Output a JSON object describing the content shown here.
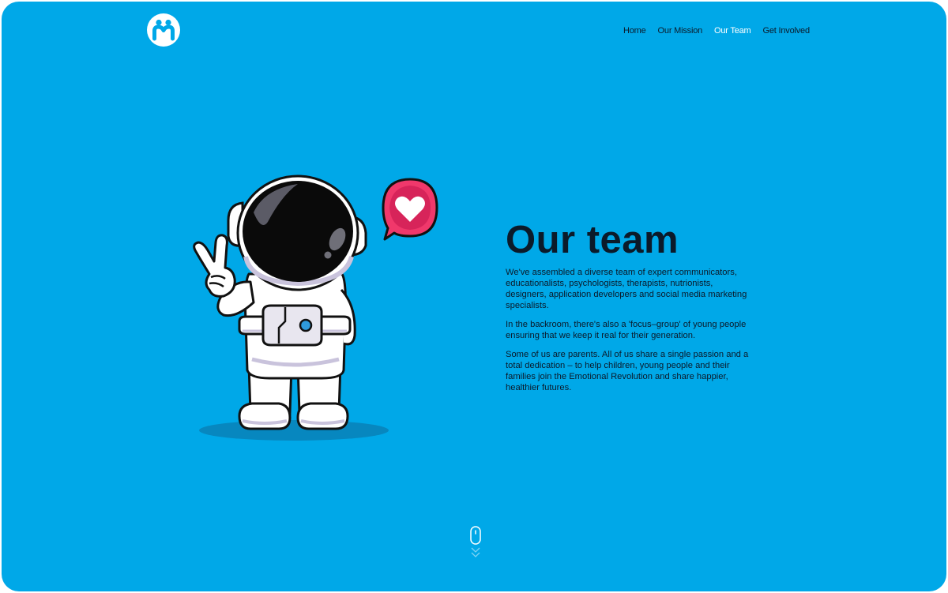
{
  "brand": {
    "logo_icon": "family-people-icon",
    "accent": "#00a8e8",
    "heart_color": "#f0386b"
  },
  "nav": {
    "items": [
      {
        "label": "Home",
        "active": false
      },
      {
        "label": "Our Mission",
        "active": false
      },
      {
        "label": "Our Team",
        "active": true
      },
      {
        "label": "Get Involved",
        "active": false
      }
    ]
  },
  "hero": {
    "illustration": "astronaut-peace-sign-heart-icon",
    "title": "Our team",
    "paragraphs": [
      "We've assembled a diverse team of expert communicators, educationalists, psychologists, therapists, nutrionists, designers, application developers and social media marketing specialists.",
      "In the backroom, there's also a 'focus–group' of young people ensuring that we keep it real for their generation.",
      "Some of us are parents. All of us share a single passion and a total dedication – to help children, young people and their families join the Emotional Revolution and share happier, healthier futures."
    ]
  },
  "scroll": {
    "icon": "mouse-scroll-down-icon"
  }
}
